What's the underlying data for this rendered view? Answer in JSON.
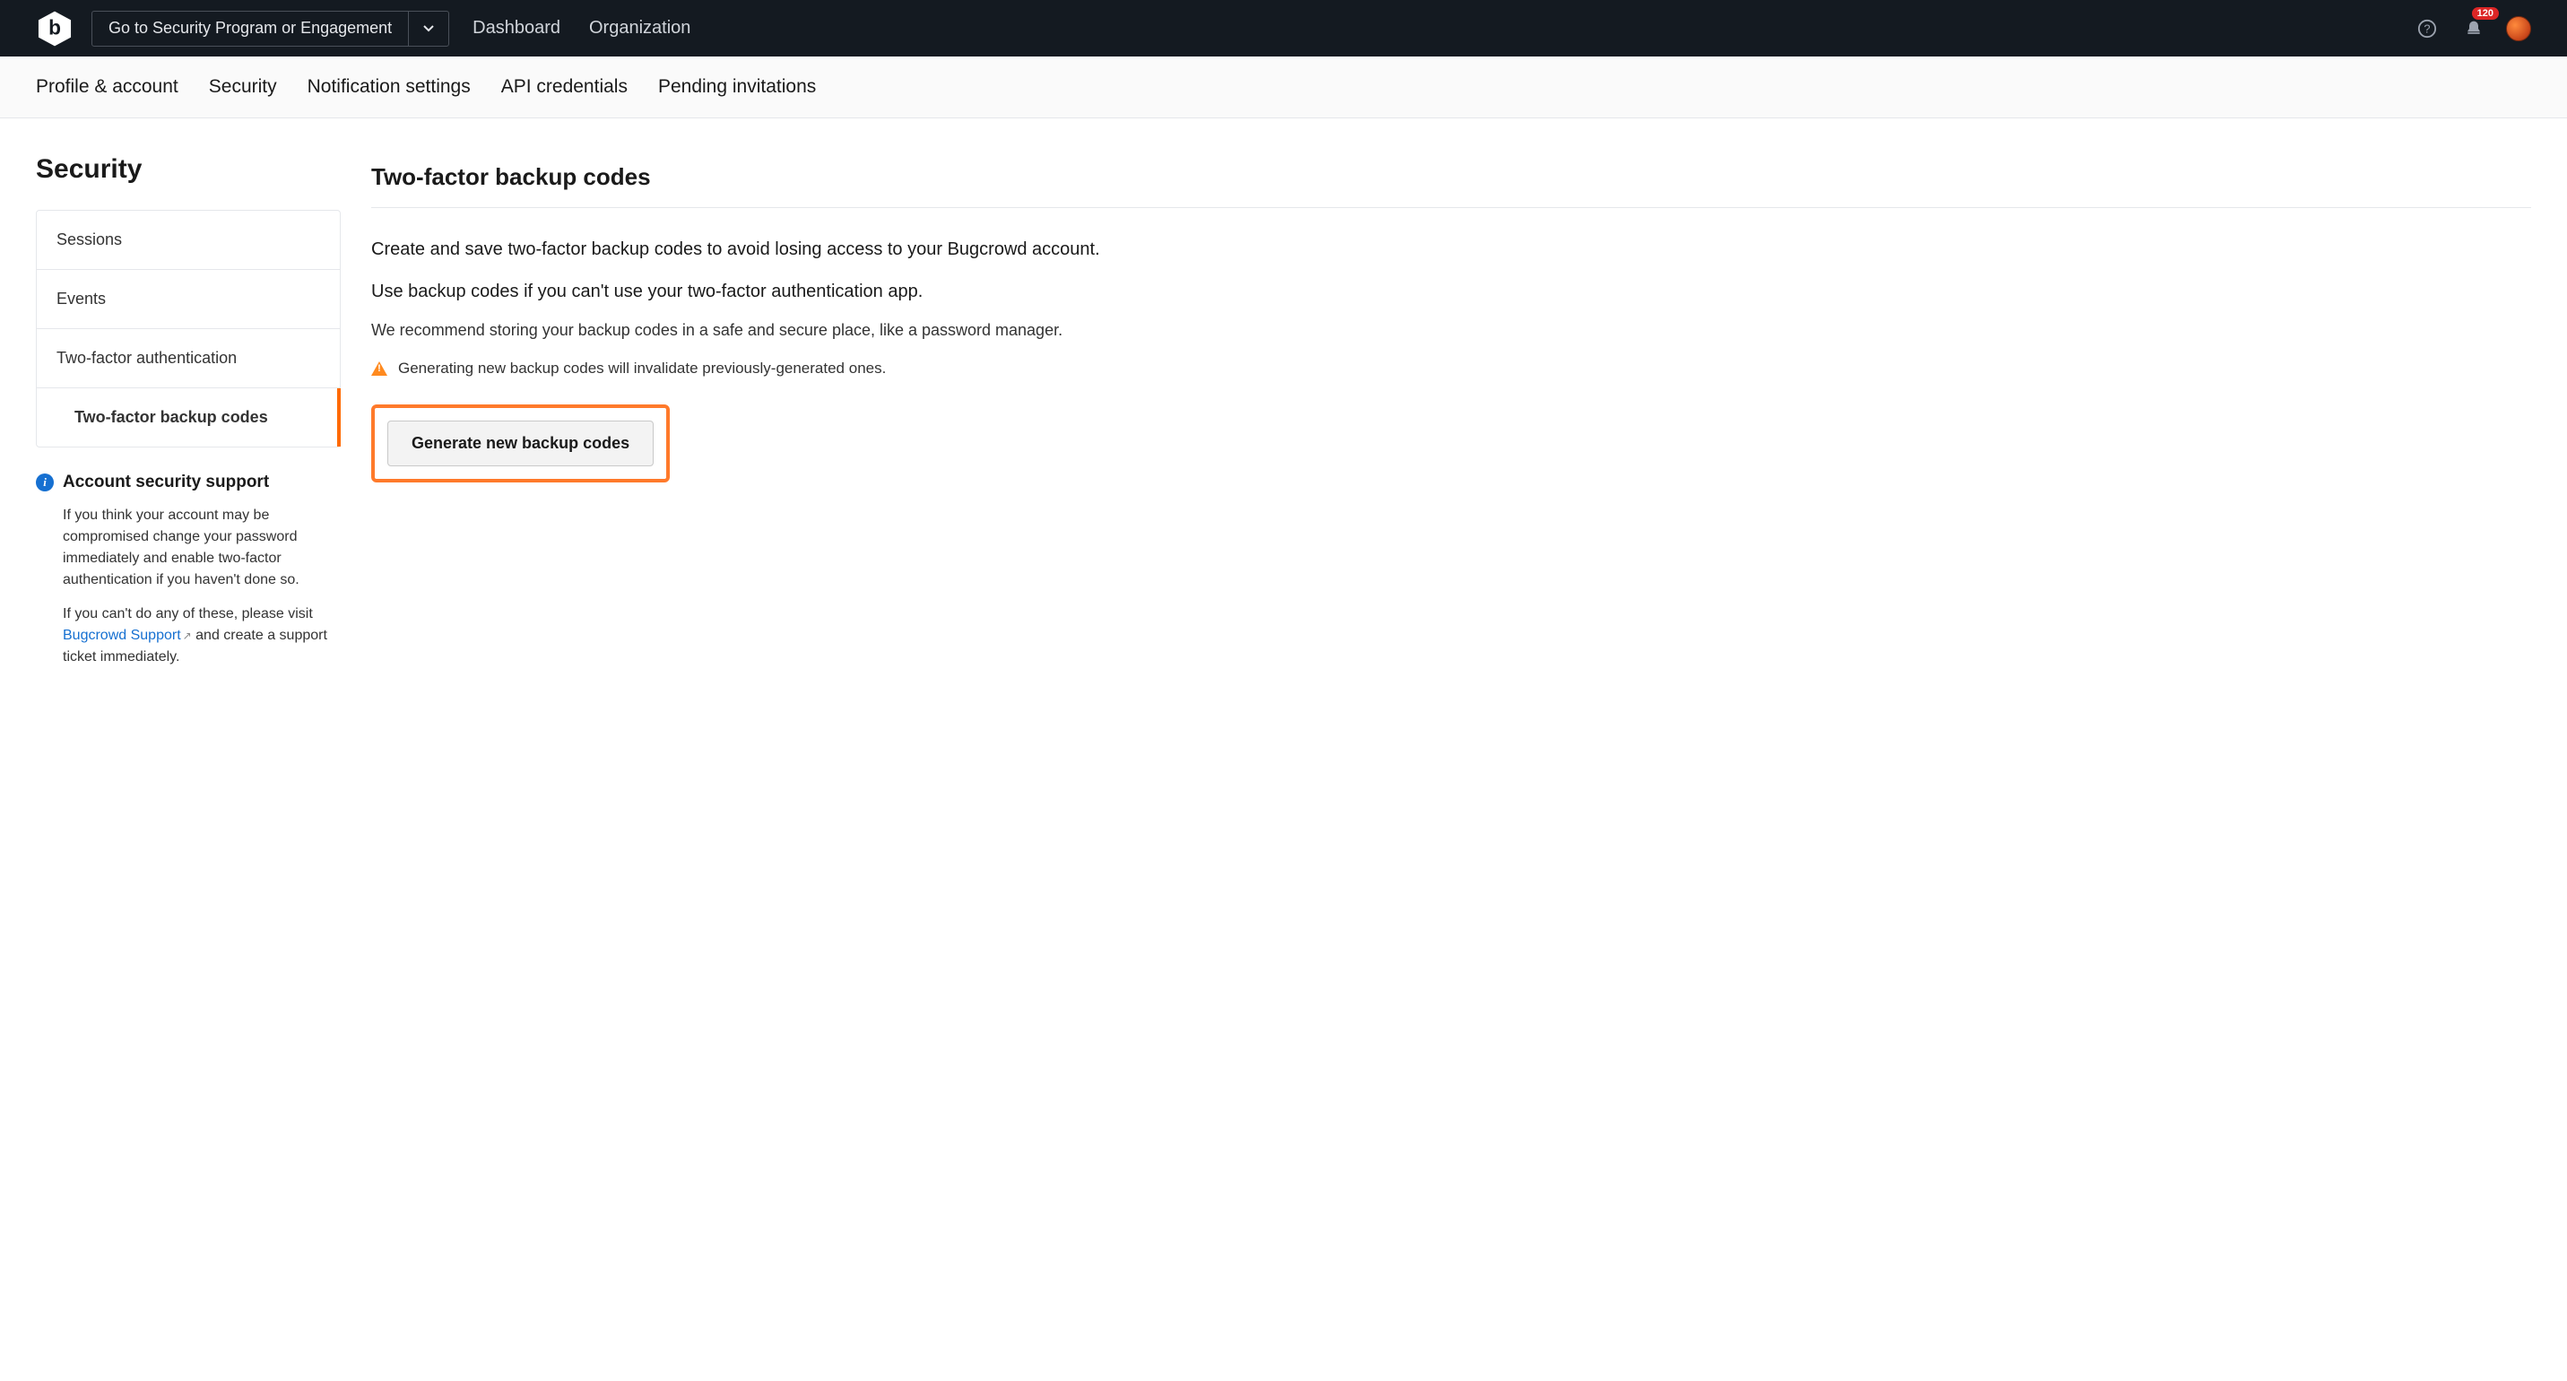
{
  "topbar": {
    "dropdown_label": "Go to Security Program or Engagement",
    "nav": {
      "dashboard": "Dashboard",
      "organization": "Organization"
    },
    "notification_count": "120"
  },
  "subnav": {
    "items": [
      "Profile & account",
      "Security",
      "Notification settings",
      "API credentials",
      "Pending invitations"
    ]
  },
  "page_title": "Security",
  "side_menu": {
    "items": [
      "Sessions",
      "Events",
      "Two-factor authentication",
      "Two-factor backup codes"
    ]
  },
  "support": {
    "title": "Account security support",
    "para1": "If you think your account may be compromised change your password immediately and enable two-factor authentication if you haven't done so.",
    "para2_pre": "If you can't do any of these, please visit ",
    "link_text": "Bugcrowd Support",
    "para2_post": " and create a support ticket immediately."
  },
  "main": {
    "heading": "Two-factor backup codes",
    "p1": "Create and save two-factor backup codes to avoid losing access to your Bugcrowd account.",
    "p2": "Use backup codes if you can't use your two-factor authentication app.",
    "p3": "We recommend storing your backup codes in a safe and secure place, like a password manager.",
    "warning": "Generating new backup codes will invalidate previously-generated ones.",
    "button_label": "Generate new backup codes"
  }
}
